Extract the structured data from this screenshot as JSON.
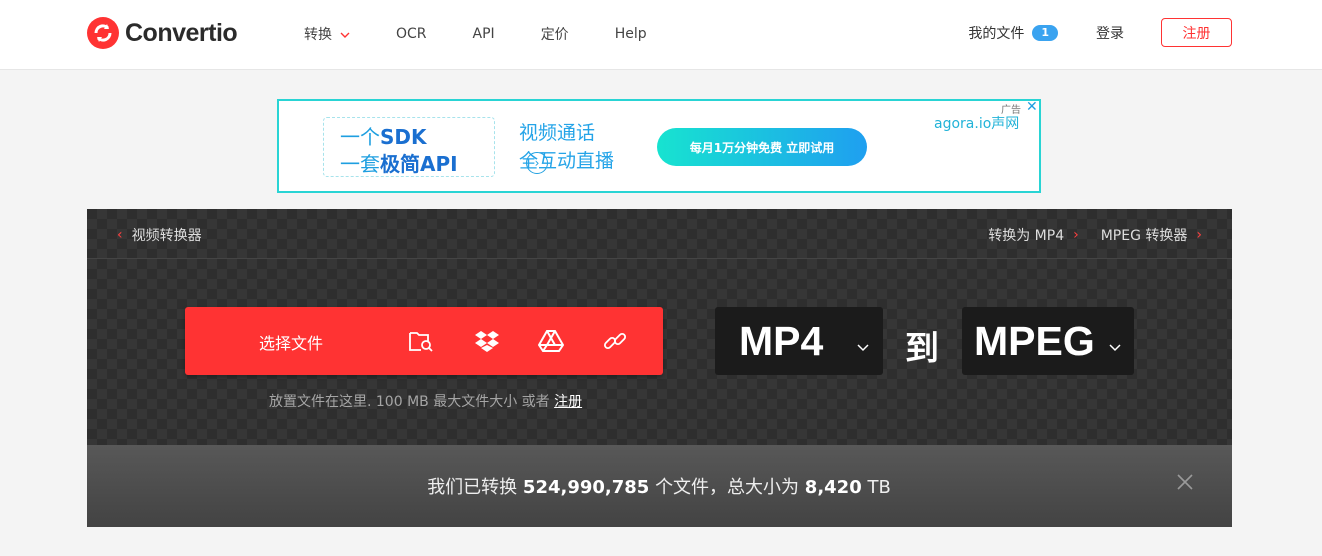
{
  "brand": {
    "name": "Convertio",
    "color": "#ff3333"
  },
  "nav": {
    "items": [
      {
        "label": "转换",
        "has_dropdown": true
      },
      {
        "label": "OCR"
      },
      {
        "label": "API"
      },
      {
        "label": "定价"
      },
      {
        "label": "Help"
      }
    ]
  },
  "header_right": {
    "my_files": "我的文件",
    "my_files_count": "1",
    "login": "登录",
    "signup": "注册"
  },
  "ad": {
    "line1_a": "一个",
    "line1_b": "SDK",
    "line2_a": "一套",
    "line2_b": "极简API",
    "mid1": "视频通话",
    "mid2": "全互动直播",
    "button": "每月1万分钟免费  立即试用",
    "brand": "agora.io声网",
    "tag": "广告",
    "close": "✕"
  },
  "breadcrumb": {
    "left": "视频转换器",
    "right1": "转换为 MP4",
    "right2": "MPEG 转换器"
  },
  "upload": {
    "label": "选择文件",
    "icons": [
      "folder-search-icon",
      "dropbox-icon",
      "google-drive-icon",
      "link-icon"
    ]
  },
  "format": {
    "from": "MP4",
    "to_word": "到",
    "to": "MPEG"
  },
  "hint": {
    "text": "放置文件在这里. 100 MB 最大文件大小 或者",
    "link": "注册"
  },
  "stats": {
    "prefix": "我们已转换",
    "files": "524,990,785",
    "middle": "个文件，总大小为",
    "size": "8,420",
    "unit": "TB"
  }
}
